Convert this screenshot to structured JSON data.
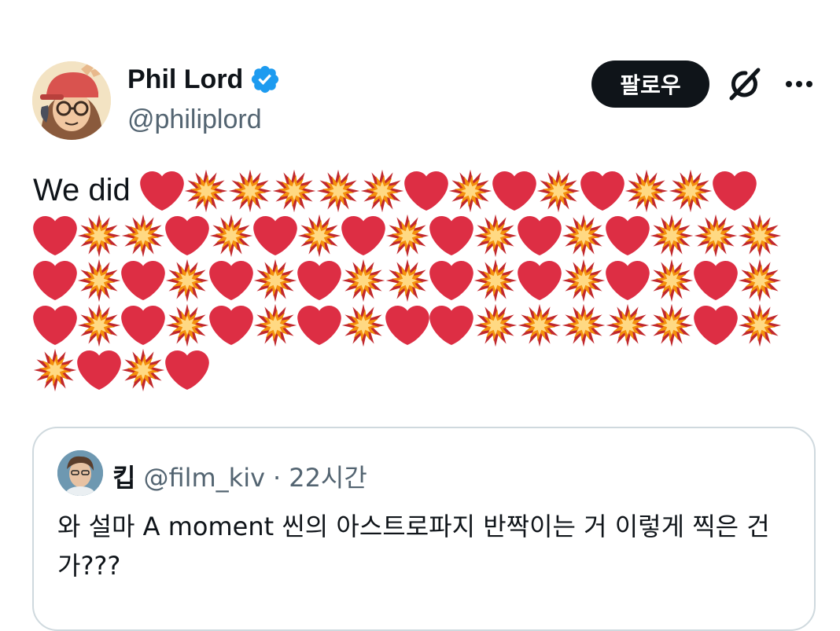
{
  "author": {
    "display_name": "Phil Lord",
    "handle": "@philiplord",
    "verified": true,
    "verified_color": "#1d9bf0"
  },
  "actions": {
    "follow_label": "팔로우",
    "grok_icon": "grok-icon",
    "more_icon": "more-icon"
  },
  "tweet": {
    "text_lead": "We did",
    "emoji_lines": [
      [
        "heart",
        "collision",
        "collision",
        "collision",
        "collision",
        "collision",
        "heart",
        "collision",
        "heart",
        "collision",
        "heart",
        "collision",
        "collision",
        "heart"
      ],
      [
        "heart",
        "collision",
        "collision",
        "heart",
        "collision",
        "heart",
        "collision",
        "heart",
        "collision",
        "heart",
        "collision",
        "heart",
        "collision",
        "heart",
        "collision",
        "collision",
        "collision"
      ],
      [
        "heart",
        "collision",
        "heart",
        "collision",
        "heart",
        "collision",
        "heart",
        "collision",
        "collision",
        "heart",
        "collision",
        "heart",
        "collision",
        "heart",
        "collision",
        "heart",
        "collision"
      ],
      [
        "heart",
        "collision",
        "heart",
        "collision",
        "heart",
        "collision",
        "heart",
        "collision",
        "heart",
        "heart",
        "collision",
        "collision",
        "collision",
        "collision",
        "collision",
        "heart",
        "collision"
      ],
      [
        "collision",
        "heart",
        "collision",
        "heart"
      ]
    ]
  },
  "quote": {
    "display_name": "킵",
    "handle": "@film_kiv",
    "separator": "·",
    "time": "22시간",
    "text": "와 설마 A moment 씬의 아스트로파지 반짝이는 거 이렇게 찍은 건가???"
  },
  "colors": {
    "heart": "#dd2e44",
    "collision_outer": "#c1282c",
    "collision_mid": "#f4900c",
    "collision_inner": "#ffd983",
    "follow_bg": "#0f1419",
    "secondary_text": "#536471",
    "border": "#cfd9de"
  }
}
